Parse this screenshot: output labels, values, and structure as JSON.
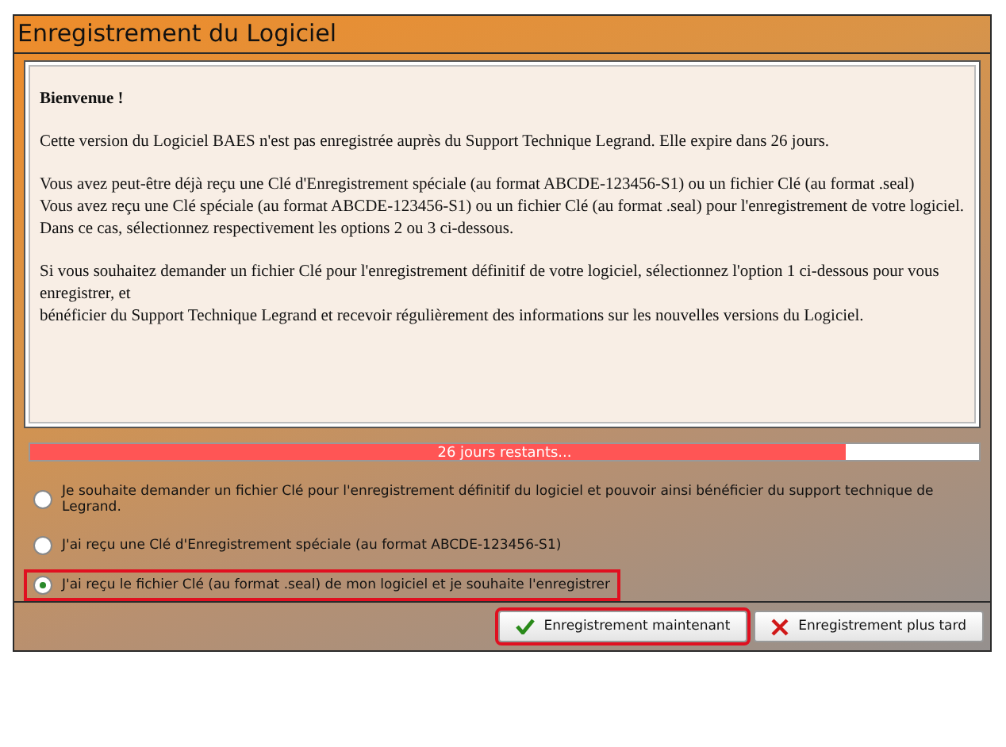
{
  "window": {
    "title": "Enregistrement du Logiciel"
  },
  "message": {
    "heading": "Bienvenue !",
    "paragraphs": [
      {
        "lines": [
          "Cette version du Logiciel BAES n'est pas enregistrée auprès du Support Technique Legrand. Elle expire dans 26 jours."
        ]
      },
      {
        "lines": [
          "Vous avez peut-être déjà reçu une Clé d'Enregistrement spéciale (au format ABCDE-123456-S1) ou un fichier Clé (au format .seal)",
          "Vous avez reçu une Clé spéciale (au format ABCDE-123456-S1) ou un fichier Clé (au format .seal) pour l'enregistrement de votre logiciel. Dans ce cas, sélectionnez respectivement les options 2 ou 3 ci-dessous."
        ]
      },
      {
        "lines": [
          "Si vous souhaitez demander un fichier Clé pour l'enregistrement définitif de votre logiciel, sélectionnez l'option 1 ci-dessous pour vous enregistrer, et",
          "bénéficier du Support Technique Legrand et recevoir régulièrement des informations sur les nouvelles versions du Logiciel."
        ]
      }
    ]
  },
  "progress": {
    "label": "26  jours restants...",
    "level": 0.86
  },
  "options": [
    {
      "label": "Je souhaite demander un fichier Clé pour l'enregistrement définitif du logiciel et pouvoir ainsi bénéficier du support technique de Legrand.",
      "selected": false
    },
    {
      "label": "J'ai reçu une Clé d'Enregistrement spéciale (au format ABCDE-123456-S1)",
      "selected": false
    },
    {
      "label": "J'ai reçu le fichier Clé (au format .seal) de mon logiciel et je souhaite l'enregistrer",
      "selected": true
    }
  ],
  "buttons": [
    {
      "label": "Enregistrement maintenant",
      "kind": "ok",
      "highlighted": true
    },
    {
      "label": "Enregistrement plus tard",
      "kind": "cancel",
      "highlighted": false
    }
  ]
}
